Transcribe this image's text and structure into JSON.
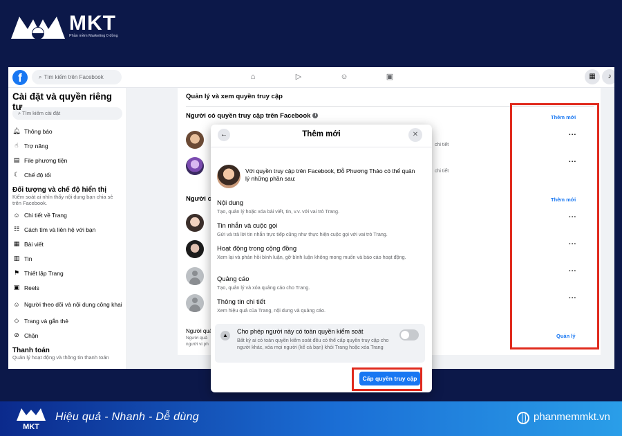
{
  "brand": {
    "name": "MKT",
    "tagline": "Phần mềm Marketing 0 đồng"
  },
  "facebook": {
    "logo_letter": "f",
    "search_placeholder": "Tìm kiếm trên Facebook"
  },
  "sidebar": {
    "title": "Cài đặt và quyền riêng tư",
    "search_placeholder": "Tìm kiếm cài đặt",
    "items_top": [
      {
        "label": "Thông báo",
        "icon": "bell-icon"
      },
      {
        "label": "Trợ năng",
        "icon": "accessibility-icon"
      },
      {
        "label": "File phương tiện",
        "icon": "media-icon"
      },
      {
        "label": "Chế độ tối",
        "icon": "moon-icon"
      }
    ],
    "section_audience": {
      "title": "Đối tượng và chế độ hiển thị",
      "subtitle": "Kiểm soát ai nhìn thấy nội dung bạn chia sẻ trên Facebook."
    },
    "items_audience": [
      {
        "label": "Chi tiết về Trang",
        "icon": "profile-icon"
      },
      {
        "label": "Cách tìm và liên hệ với bạn",
        "icon": "contact-icon"
      },
      {
        "label": "Bài viết",
        "icon": "post-icon"
      },
      {
        "label": "Tin",
        "icon": "book-icon"
      },
      {
        "label": "Thiết lập Trang",
        "icon": "flag-icon"
      },
      {
        "label": "Reels",
        "icon": "reels-icon"
      },
      {
        "label": "Người theo dõi và nội dung công khai",
        "icon": "followers-icon"
      },
      {
        "label": "Trang và gắn thẻ",
        "icon": "tag-icon"
      },
      {
        "label": "Chặn",
        "icon": "block-icon"
      }
    ],
    "section_payment": {
      "title": "Thanh toán",
      "subtitle": "Quản lý hoạt động và thông tin thanh toán"
    }
  },
  "main": {
    "heading": "Quản lý và xem quyền truy cập",
    "people_heading": "Người có quyền truy cập trên Facebook",
    "add_new_link": "Thêm mới",
    "add_new_link_2": "Thêm mới",
    "detail_text": "chi tiết",
    "others_heading": "Người c",
    "bottom_title": "Người quả",
    "bottom_sub_1": "Người quả",
    "bottom_sub_2": "người vi ph",
    "manage_link": "Quản lý",
    "more_menu": "..."
  },
  "modal": {
    "title": "Thêm mới",
    "intro": "Với quyền truy cập trên Facebook, Đỗ Phương Thảo có thể quản lý những phần sau:",
    "permissions": [
      {
        "title": "Nội dung",
        "desc": "Tạo, quản lý hoặc xóa bài viết, tin, v.v. với vai trò Trang."
      },
      {
        "title": "Tin nhắn và cuộc gọi",
        "desc": "Gửi và trả lời tin nhắn trực tiếp cũng như thực hiện cuộc gọi với vai trò Trang."
      },
      {
        "title": "Hoạt động trong cộng đồng",
        "desc": "Xem lại và phản hồi bình luận, gỡ bình luận không mong muốn và báo cáo hoạt động."
      },
      {
        "title": "Quảng cáo",
        "desc": "Tạo, quản lý và xóa quảng cáo cho Trang."
      },
      {
        "title": "Thông tin chi tiết",
        "desc": "Xem hiệu quả của Trang, nội dung và quảng cáo."
      }
    ],
    "full_control": {
      "title": "Cho phép người này có toàn quyền kiểm soát",
      "desc": "Bất kỳ ai có toàn quyền kiểm soát đều có thể cấp quyền truy cập cho người khác, xóa mọi người (kể cả bạn) khỏi Trang hoặc xóa Trang",
      "enabled": false
    },
    "grant_button": "Cấp quyền truy cập"
  },
  "footer": {
    "slogan": "Hiệu quả - Nhanh  - Dễ dùng",
    "website": "phanmemmkt.vn"
  },
  "colors": {
    "background": "#0c1849",
    "facebook_blue": "#1877f2",
    "highlight_red": "#e02a1d"
  }
}
